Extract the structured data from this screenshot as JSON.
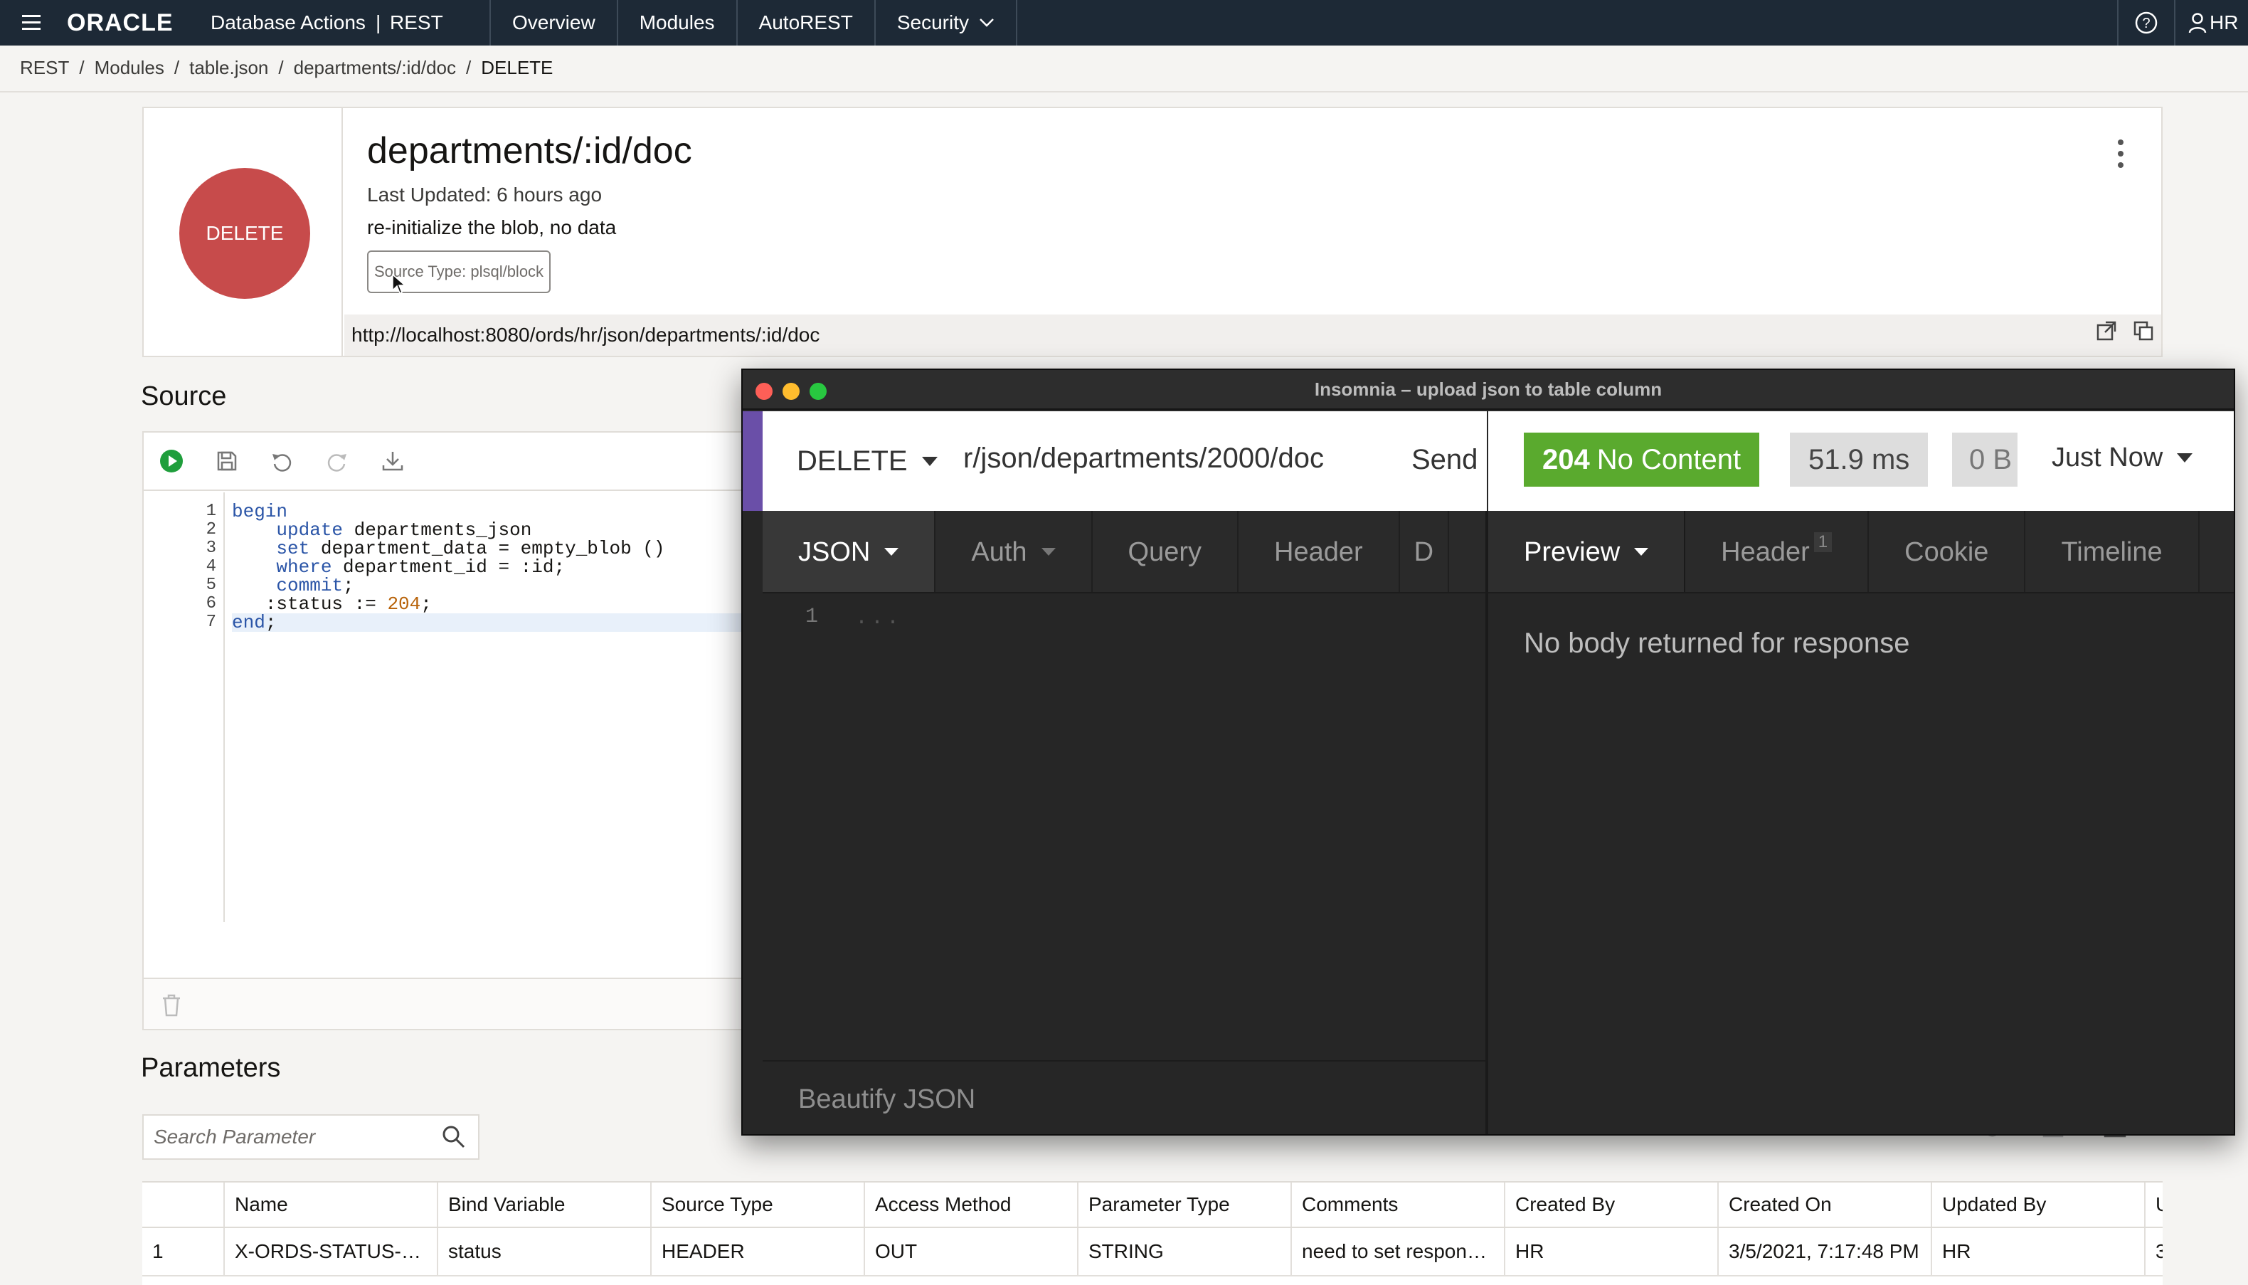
{
  "topbar": {
    "brand": "ORACLE",
    "app": "Database Actions",
    "separator": "|",
    "section": "REST",
    "nav": [
      "Overview",
      "Modules",
      "AutoREST",
      "Security"
    ],
    "user": "HR"
  },
  "breadcrumb": [
    "REST",
    "Modules",
    "table.json",
    "departments/:id/doc",
    "DELETE"
  ],
  "breadcrumb_sep": "/",
  "handler": {
    "method": "DELETE",
    "title": "departments/:id/doc",
    "updated": "Last Updated: 6 hours ago",
    "description": "re-initialize the blob, no data",
    "source_type": "Source Type: plsql/block",
    "url": "http://localhost:8080/ords/hr/json/departments/:id/doc",
    "method_color": "#c74b4b"
  },
  "source": {
    "title": "Source",
    "line_numbers": [
      "1",
      "2",
      "3",
      "4",
      "5",
      "6",
      "7"
    ]
  },
  "parameters": {
    "title": "Parameters",
    "search_placeholder": "Search Parameter",
    "columns": [
      "",
      "Name",
      "Bind Variable",
      "Source Type",
      "Access Method",
      "Parameter Type",
      "Comments",
      "Created By",
      "Created On",
      "Updated By",
      "U"
    ],
    "rows": [
      [
        "1",
        "X-ORDS-STATUS-…",
        "status",
        "HEADER",
        "OUT",
        "STRING",
        "need to set respon…",
        "HR",
        "3/5/2021, 7:17:48 PM",
        "HR",
        "3"
      ]
    ]
  },
  "insomnia": {
    "window_title": "Insomnia – upload json to table column",
    "method": "DELETE",
    "url": "r/json/departments/2000/doc",
    "send": "Send",
    "status_code": "204",
    "status_text": "No Content",
    "time": "51.9 ms",
    "size": "0 B",
    "when": "Just Now",
    "request_tabs": [
      "JSON",
      "Auth",
      "Query",
      "Header",
      "D"
    ],
    "response_tabs": [
      "Preview",
      "Header",
      "Cookie",
      "Timeline"
    ],
    "header_count": "1",
    "editor_line": "1",
    "editor_placeholder": "...",
    "beautify": "Beautify JSON",
    "empty_message": "No body returned for response",
    "accent": "#6a4fa8",
    "status_color": "#5aaa2e"
  }
}
